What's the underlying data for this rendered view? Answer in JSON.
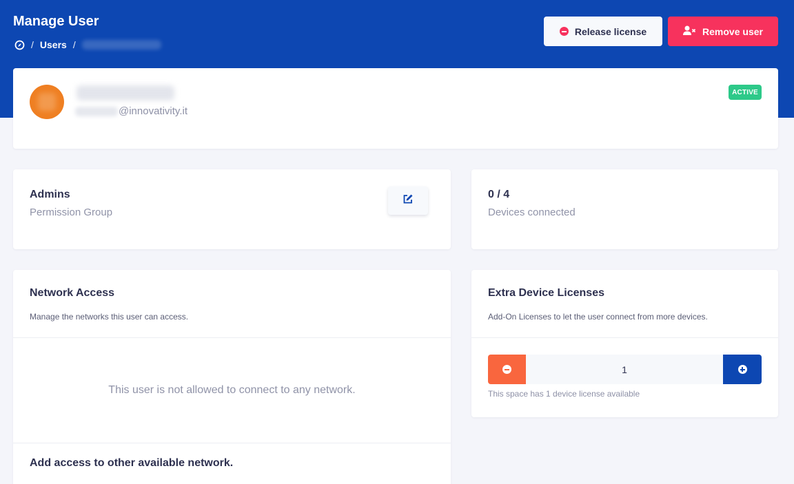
{
  "header": {
    "title": "Manage User",
    "breadcrumb": {
      "home_icon": "compass-icon",
      "separator": "/",
      "users": "Users"
    },
    "release_button": {
      "label": "Release license",
      "icon": "minus-circle-icon"
    },
    "remove_button": {
      "label": "Remove user",
      "icon": "user-remove-icon"
    }
  },
  "profile": {
    "email_domain": "@innovativity.it",
    "status": "ACTIVE"
  },
  "permission": {
    "group_name": "Admins",
    "group_label": "Permission Group",
    "edit_icon": "edit-icon"
  },
  "devices": {
    "count": "0 / 4",
    "label": "Devices connected"
  },
  "network": {
    "title": "Network Access",
    "description": "Manage the networks this user can access.",
    "empty_message": "This user is not allowed to connect to any network.",
    "add_title": "Add access to other available network."
  },
  "extra_licenses": {
    "title": "Extra Device Licenses",
    "description": "Add-On Licenses to let the user connect from more devices.",
    "value": "1",
    "note": "This space has 1 device license available"
  },
  "colors": {
    "brand_blue": "#0d47b2",
    "danger": "#f7325d",
    "success": "#2dc989",
    "orange": "#f9663e"
  }
}
